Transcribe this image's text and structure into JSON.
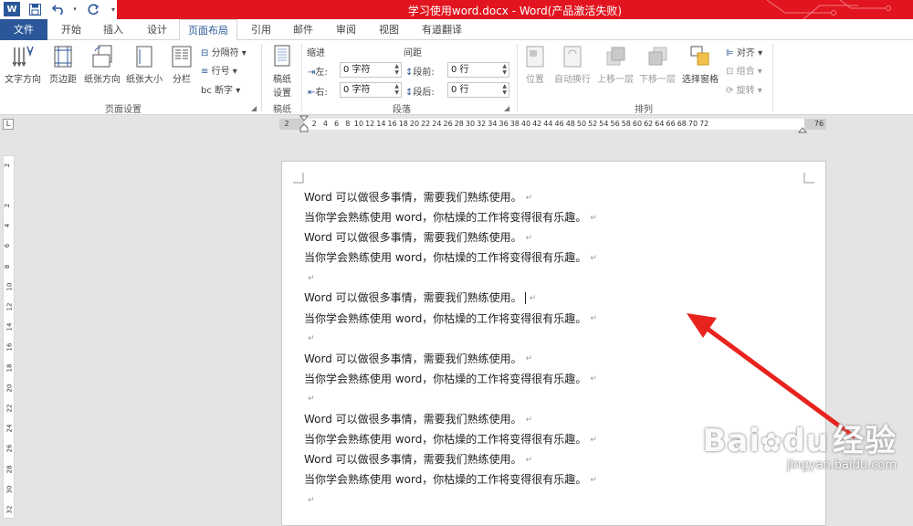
{
  "window": {
    "title": "学习使用word.docx - Word(产品激活失败)",
    "logo_letter": "W",
    "accent_color": "#2b579a",
    "titlebar_color": "#e2141f"
  },
  "quick_access": [
    {
      "name": "save-icon"
    },
    {
      "name": "undo-icon"
    },
    {
      "name": "redo-icon"
    },
    {
      "name": "customize-dropdown-icon"
    }
  ],
  "tabs": {
    "file": "文件",
    "home": "开始",
    "insert": "插入",
    "design": "设计",
    "layout": "页面布局",
    "references": "引用",
    "mailings": "邮件",
    "review": "审阅",
    "view": "视图",
    "translate": "有道翻译"
  },
  "ribbon": {
    "page_setup": {
      "text_direction": "文字方向",
      "margins": "页边距",
      "orientation": "纸张方向",
      "size": "纸张大小",
      "columns": "分栏",
      "breaks": "分隔符",
      "line_numbers": "行号",
      "hyphenation": "断字",
      "group_label": "页面设置"
    },
    "manuscript": {
      "button_line1": "稿纸",
      "button_line2": "设置",
      "group_label": "稿纸"
    },
    "paragraph": {
      "indent_title": "缩进",
      "spacing_title": "间距",
      "indent_left_label": "左:",
      "indent_left_value": "0 字符",
      "indent_right_label": "右:",
      "indent_right_value": "0 字符",
      "spacing_before_label": "段前:",
      "spacing_before_value": "0 行",
      "spacing_after_label": "段后:",
      "spacing_after_value": "0 行",
      "group_label": "段落"
    },
    "arrange": {
      "position": "位置",
      "wrap_text": "自动换行",
      "bring_forward": "上移一层",
      "send_backward": "下移一层",
      "selection_pane": "选择窗格",
      "align": "对齐",
      "group": "组合",
      "rotate": "旋转",
      "group_label": "排列"
    }
  },
  "ruler": {
    "corner_symbol": "L",
    "h_ticks": [
      "2",
      "2",
      "4",
      "6",
      "8",
      "10",
      "12",
      "14",
      "16",
      "18",
      "20",
      "22",
      "24",
      "26",
      "28",
      "30",
      "32",
      "34",
      "36",
      "38",
      "40",
      "42",
      "44",
      "46",
      "48",
      "50",
      "52",
      "54",
      "56",
      "58",
      "60",
      "62",
      "64",
      "66",
      "68",
      "70",
      "72",
      "76"
    ],
    "v_ticks": [
      "2",
      "2",
      "4",
      "6",
      "8",
      "10",
      "12",
      "14",
      "16",
      "18",
      "20",
      "22",
      "24",
      "26",
      "28",
      "30",
      "32"
    ]
  },
  "document": {
    "paragraph_mark": "↵",
    "lines": [
      "Word 可以做很多事情，需要我们熟练使用。",
      "当你学会熟练使用 word，你枯燥的工作将变得很有乐趣。",
      "Word 可以做很多事情，需要我们熟练使用。",
      "当你学会熟练使用 word，你枯燥的工作将变得很有乐趣。",
      "",
      "Word 可以做很多事情，需要我们熟练使用。",
      "当你学会熟练使用 word，你枯燥的工作将变得很有乐趣。",
      "",
      "Word 可以做很多事情，需要我们熟练使用。",
      "当你学会熟练使用 word，你枯燥的工作将变得很有乐趣。",
      "",
      "Word 可以做很多事情，需要我们熟练使用。",
      "当你学会熟练使用 word，你枯燥的工作将变得很有乐趣。",
      "Word 可以做很多事情，需要我们熟练使用。",
      "当你学会熟练使用 word，你枯燥的工作将变得很有乐趣。",
      ""
    ],
    "cursor_line_index": 5
  },
  "annotation": {
    "arrow_color": "#e8231e"
  },
  "watermark": {
    "brand": "Bai",
    "brand_suffix": "du",
    "product": "经验",
    "url": "jingyan.baidu.com"
  }
}
